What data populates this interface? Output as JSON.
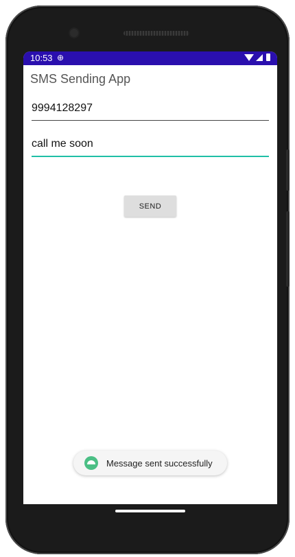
{
  "status_bar": {
    "time": "10:53",
    "globe_glyph": "⊕",
    "icons": [
      "wifi-icon",
      "signal-icon",
      "battery-icon"
    ],
    "background": "#2a0fae"
  },
  "app": {
    "title": "SMS Sending App"
  },
  "form": {
    "phone_value": "9994128297",
    "message_value": "call me soon",
    "send_label": "SEND",
    "accent_color": "#1fbfa6"
  },
  "toast": {
    "icon": "app-icon",
    "message": "Message sent successfully"
  }
}
